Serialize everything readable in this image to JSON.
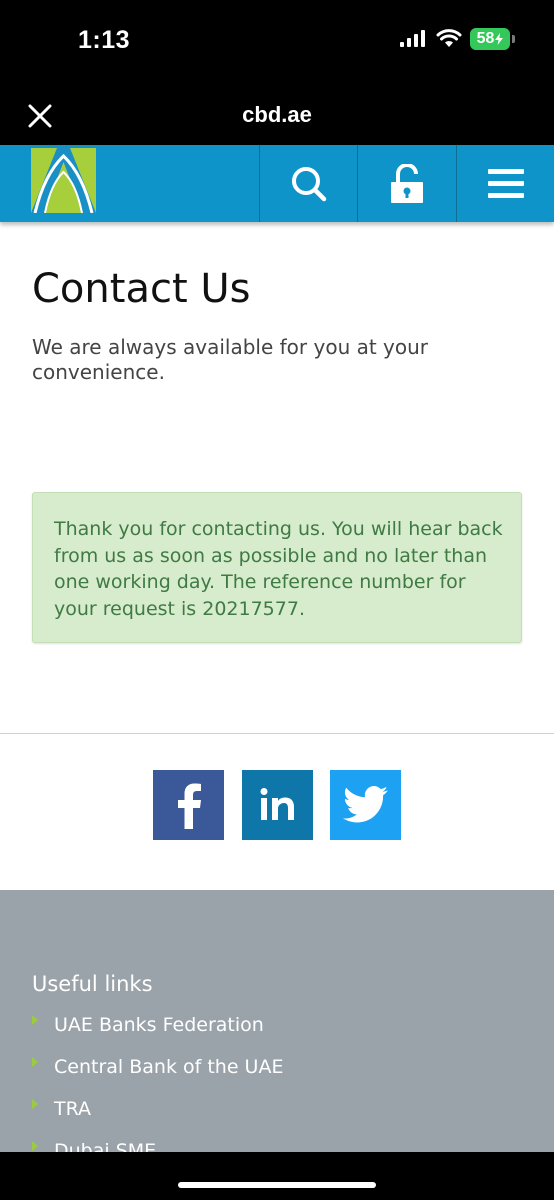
{
  "status_bar": {
    "time": "1:13",
    "battery": "58"
  },
  "browser": {
    "title": "cbd.ae"
  },
  "header": {
    "brand_color": "#0f94c9",
    "icons": [
      "search-icon",
      "lock-icon",
      "menu-icon"
    ]
  },
  "main": {
    "title": "Contact Us",
    "subtitle": "We are always available for you at your convenience.",
    "success_message": "Thank you for contacting us. You will hear back from us as soon as possible and no later than one working day. The reference number for your request is 20217577."
  },
  "social": [
    "facebook-icon",
    "linkedin-icon",
    "twitter-icon"
  ],
  "footer": {
    "title": "Useful links",
    "links": [
      {
        "label": "UAE Banks Federation"
      },
      {
        "label": "Central Bank of the UAE"
      },
      {
        "label": "TRA"
      },
      {
        "label": "Dubai SME"
      }
    ]
  }
}
